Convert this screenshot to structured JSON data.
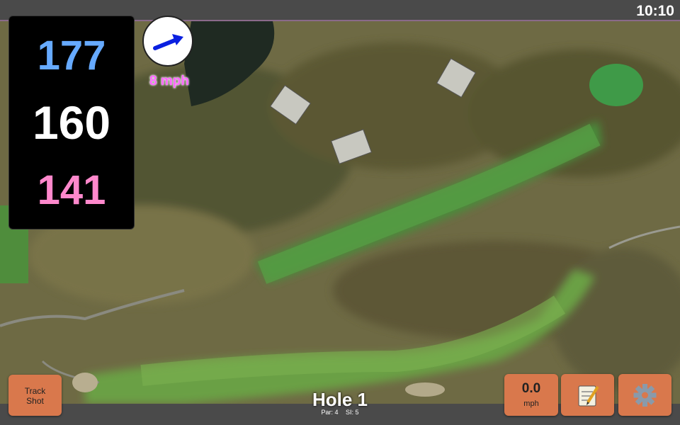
{
  "status": {
    "time": "10:10"
  },
  "yardage": {
    "back": "177",
    "middle": "160",
    "front": "141"
  },
  "wind": {
    "speed_label": "8 mph",
    "icon": "wind-arrow-icon"
  },
  "controls": {
    "track_shot_line1": "Track",
    "track_shot_line2": "Shot",
    "speed_value": "0.0",
    "speed_unit": "mph",
    "notes_icon": "notepad-icon",
    "settings_icon": "gear-icon"
  },
  "hole": {
    "title": "Hole 1",
    "par": "Par: 4",
    "si": "SI: 5"
  },
  "colors": {
    "back_yardage": "#66aaff",
    "mid_yardage": "#ffffff",
    "front_yardage": "#ff88cc",
    "wind_label": "#ff66ff",
    "button": "#d9784c"
  }
}
